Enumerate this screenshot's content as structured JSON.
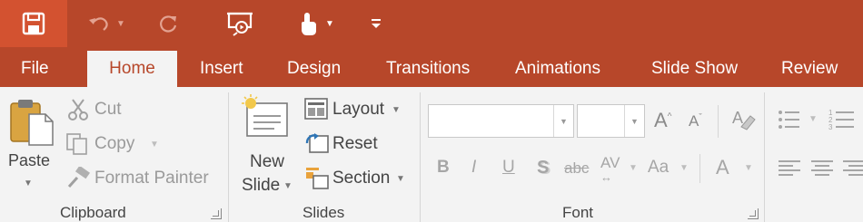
{
  "quick_access": {
    "save": "save-icon",
    "undo": "undo-icon",
    "redo": "redo-icon",
    "present": "presenter-icon",
    "touch": "touch-mode-icon",
    "customize": "customize-icon"
  },
  "tabs": [
    "File",
    "Home",
    "Insert",
    "Design",
    "Transitions",
    "Animations",
    "Slide Show",
    "Review"
  ],
  "active_tab": "Home",
  "clipboard": {
    "paste": "Paste",
    "cut": "Cut",
    "copy": "Copy",
    "format_painter": "Format Painter",
    "group_label": "Clipboard"
  },
  "slides": {
    "new_slide_line1": "New",
    "new_slide_line2": "Slide",
    "layout": "Layout",
    "reset": "Reset",
    "section": "Section",
    "group_label": "Slides"
  },
  "font": {
    "font_name_value": "",
    "font_size_value": "",
    "grow": "A",
    "shrink": "A",
    "bold": "B",
    "italic": "I",
    "underline": "U",
    "shadow": "S",
    "strikethrough": "abc",
    "spacing": "AV",
    "change_case": "Aa",
    "color": "A",
    "group_label": "Font"
  },
  "colors": {
    "brand": "#b7472a",
    "save_highlight": "#d35230",
    "ribbon_bg": "#f3f3f3"
  }
}
